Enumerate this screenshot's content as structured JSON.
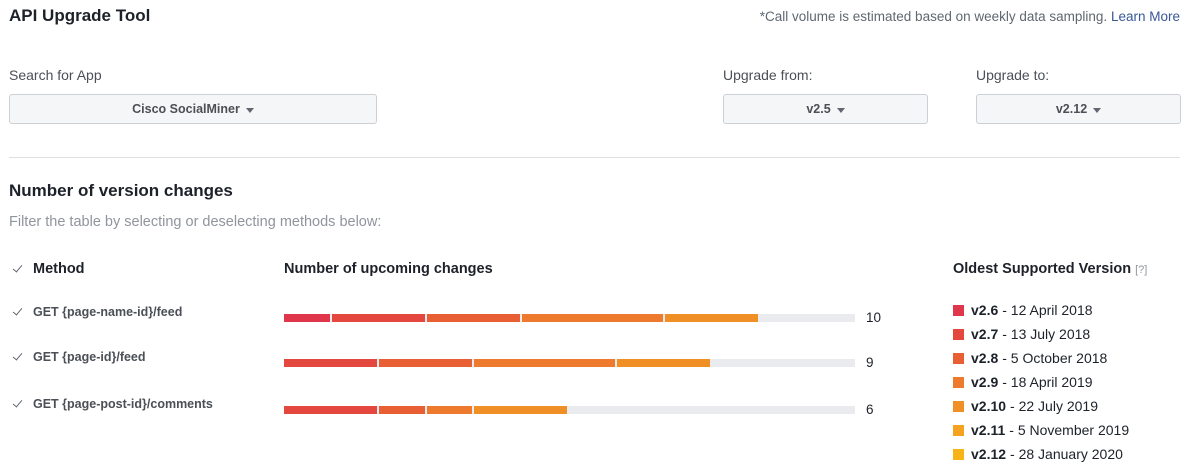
{
  "header": {
    "title": "API Upgrade Tool",
    "note": "*Call volume is estimated based on weekly data sampling.",
    "learn_more": "Learn More"
  },
  "filters": {
    "search_label": "Search for App",
    "search_value": "Cisco SocialMiner",
    "from_label": "Upgrade from:",
    "from_value": "v2.5",
    "to_label": "Upgrade to:",
    "to_value": "v2.12"
  },
  "section": {
    "title": "Number of version changes",
    "subtitle": "Filter the table by selecting or deselecting methods below:",
    "col_method": "Method",
    "col_changes": "Number of upcoming changes",
    "col_oldest": "Oldest Supported Version",
    "help": "[?]"
  },
  "colors": {
    "v2.6": "#e0364b",
    "v2.7": "#e4473e",
    "v2.8": "#e85f34",
    "v2.9": "#ee7a2e",
    "v2.10": "#f08f26",
    "v2.11": "#f4a21f",
    "v2.12": "#f7b318"
  },
  "methods": [
    {
      "name": "GET {page-name-id}/feed",
      "checked": true,
      "count": "10",
      "segments": [
        {
          "v": "v2.6",
          "n": 1
        },
        {
          "v": "v2.7",
          "n": 2
        },
        {
          "v": "v2.8",
          "n": 2
        },
        {
          "v": "v2.9",
          "n": 3
        },
        {
          "v": "v2.10",
          "n": 2
        }
      ]
    },
    {
      "name": "GET {page-id}/feed",
      "checked": true,
      "count": "9",
      "segments": [
        {
          "v": "v2.7",
          "n": 2
        },
        {
          "v": "v2.8",
          "n": 2
        },
        {
          "v": "v2.9",
          "n": 3
        },
        {
          "v": "v2.10",
          "n": 2
        }
      ]
    },
    {
      "name": "GET {page-post-id}/comments",
      "checked": true,
      "count": "6",
      "segments": [
        {
          "v": "v2.7",
          "n": 2
        },
        {
          "v": "v2.8",
          "n": 1
        },
        {
          "v": "v2.9",
          "n": 1
        },
        {
          "v": "v2.10",
          "n": 2
        }
      ]
    }
  ],
  "bar_max": 12,
  "legend": [
    {
      "version": "v2.6",
      "date": "- 12 April 2018"
    },
    {
      "version": "v2.7",
      "date": "- 13 July 2018"
    },
    {
      "version": "v2.8",
      "date": "- 5 October 2018"
    },
    {
      "version": "v2.9",
      "date": "- 18 April 2019"
    },
    {
      "version": "v2.10",
      "date": "- 22 July 2019"
    },
    {
      "version": "v2.11",
      "date": "- 5 November 2019"
    },
    {
      "version": "v2.12",
      "date": "- 28 January 2020"
    }
  ]
}
